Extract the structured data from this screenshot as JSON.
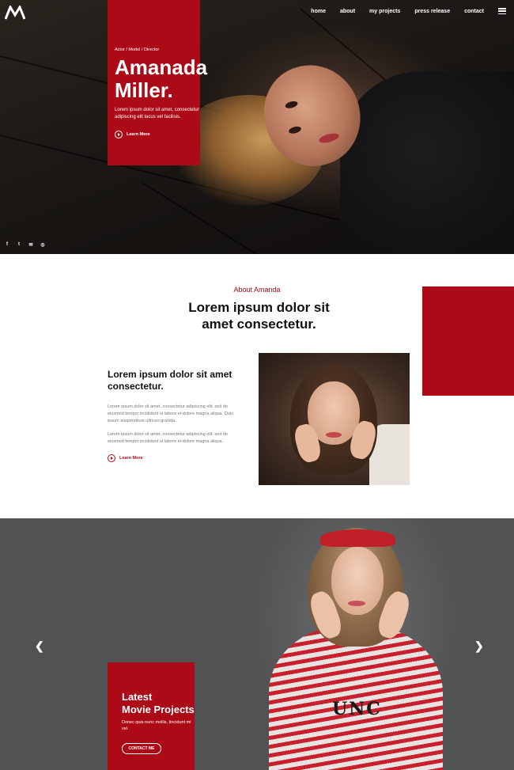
{
  "brand": {
    "logo": "M",
    "accent": "#ac0a17"
  },
  "nav": {
    "items": [
      "home",
      "about",
      "my projects",
      "press release",
      "contact"
    ]
  },
  "hero": {
    "tagline": "Actor / Model / Director",
    "name_line1": "Amanada",
    "name_line2": "Miller.",
    "description": "Lorem ipsum dolor sit amet, consectetur adipiscing elit lacus vel facilisis.",
    "learn_more": "Learn More",
    "social": [
      "f",
      "t",
      "✉",
      "◎"
    ]
  },
  "about": {
    "label": "About Amanda",
    "title_line1": "Lorem ipsum dolor sit",
    "title_line2": "amet consectetur.",
    "heading": "Lorem ipsum dolor sit amet consectetur.",
    "paragraph1": "Lorem ipsum dolor sit amet, consectetur adipiscing elit, sed do eiusmod tempor incididunt ut labore et dolore magna aliqua. Quis ipsum suspendisse ultrices gravida.",
    "paragraph2": "Lorem ipsum dolor sit amet, consectetur adipiscing elit, sed do eiusmod tempor incididunt ut labore et dolore magna aliqua.",
    "learn_more": "Learn More"
  },
  "projects": {
    "title_line1": "Latest",
    "title_line2": "Movie Projects",
    "description": "Donec quis nunc mollis, tincidunt mi vel.",
    "contact_button": "CONTACT ME",
    "prev_arrow": "❮",
    "next_arrow": "❯",
    "shirt_print": "UNC"
  }
}
